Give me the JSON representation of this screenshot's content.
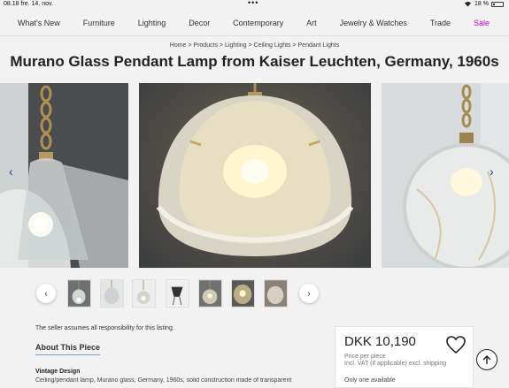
{
  "status_bar": {
    "time": "08.18",
    "date": "fre. 14. nov.",
    "battery": "18 %",
    "dots": "•••"
  },
  "nav": {
    "items": [
      "What's New",
      "Furniture",
      "Lighting",
      "Decor",
      "Contemporary",
      "Art",
      "Jewelry & Watches",
      "Trade"
    ],
    "sale": "Sale",
    "sale_color": "#c200c8"
  },
  "breadcrumb": "Home > Products > Lighting > Ceiling Lights > Pendant Lights",
  "title": "Murano Glass Pendant Lamp from Kaiser Leuchten, Germany, 1960s",
  "gallery": {
    "prev_icon": "‹",
    "next_icon": "›",
    "arrow_color": "#1a3d7a"
  },
  "thumbnails": {
    "prev_icon": "‹",
    "next_icon": "›",
    "count": 7
  },
  "seller_note": "The seller assumes all responsibility for this listing.",
  "about_heading": "About This Piece",
  "vintage_heading": "Vintage Design",
  "description": "Ceiling/pendant lamp, Murano glass, Germany, 1960s, solid construction made of transparent",
  "purchase": {
    "price": "DKK 10,190",
    "price_note": "Price per piece",
    "vat_note": "Incl. VAT (if applicable) excl. shipping",
    "availability": "Only one available"
  }
}
